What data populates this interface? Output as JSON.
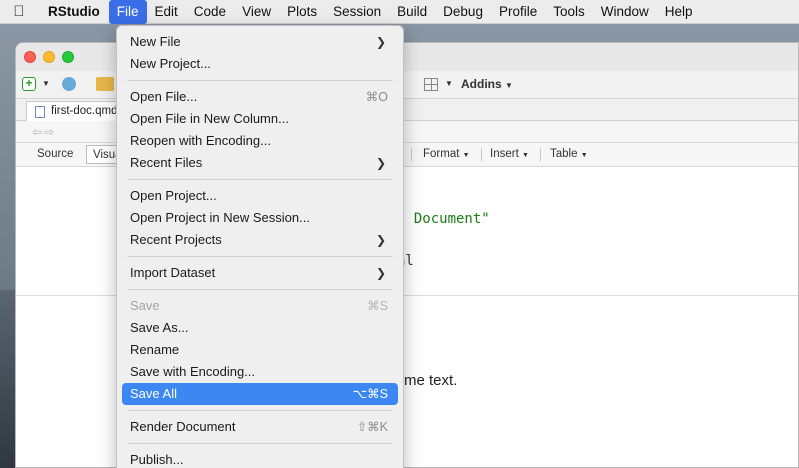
{
  "menubar": {
    "app_name": "RStudio",
    "items": [
      "File",
      "Edit",
      "Code",
      "View",
      "Plots",
      "Session",
      "Build",
      "Debug",
      "Profile",
      "Tools",
      "Window",
      "Help"
    ]
  },
  "toolbar": {
    "addins_label": "Addins"
  },
  "editor": {
    "tab_title": "first-doc.qmd",
    "mode_source": "Source",
    "mode_visual": "Visual",
    "format_buttons": [
      "Format",
      "Insert",
      "Table"
    ],
    "code_lines": [
      "t Document\"",
      "al"
    ],
    "prose_lines": [
      "me text."
    ]
  },
  "file_menu": {
    "groups": [
      [
        {
          "label": "New File",
          "submenu": true
        },
        {
          "label": "New Project..."
        }
      ],
      [
        {
          "label": "Open File...",
          "shortcut": "⌘O"
        },
        {
          "label": "Open File in New Column..."
        },
        {
          "label": "Reopen with Encoding..."
        },
        {
          "label": "Recent Files",
          "submenu": true
        }
      ],
      [
        {
          "label": "Open Project..."
        },
        {
          "label": "Open Project in New Session..."
        },
        {
          "label": "Recent Projects",
          "submenu": true
        }
      ],
      [
        {
          "label": "Import Dataset",
          "submenu": true
        }
      ],
      [
        {
          "label": "Save",
          "shortcut": "⌘S",
          "disabled": true
        },
        {
          "label": "Save As..."
        },
        {
          "label": "Rename"
        },
        {
          "label": "Save with Encoding..."
        },
        {
          "label": "Save All",
          "shortcut": "⌥⌘S",
          "highlighted": true
        }
      ],
      [
        {
          "label": "Render Document",
          "shortcut": "⇧⌘K"
        }
      ],
      [
        {
          "label": "Publish..."
        }
      ]
    ]
  },
  "colors": {
    "menu_highlight": "#3d87f3",
    "menubar_active": "#3a6ee8",
    "code_string": "#1c7c16"
  }
}
